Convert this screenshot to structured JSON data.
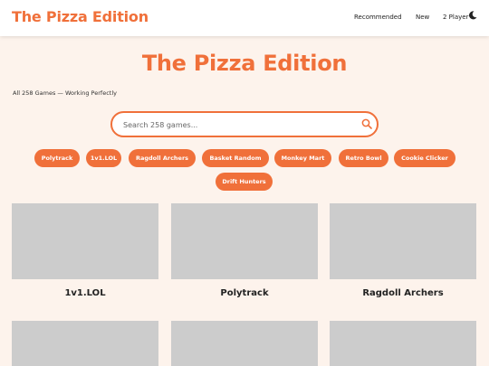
{
  "header": {
    "brand": "The Pizza Edition",
    "nav": [
      "Recommended",
      "New",
      "2 Player"
    ],
    "theme_icon": "moon-icon"
  },
  "hero": {
    "title": "The Pizza Edition",
    "subtitle": "All 258 Games — Working Perfectly"
  },
  "search": {
    "placeholder": "Search 258 games...",
    "value": "",
    "icon": "search-icon"
  },
  "chips": [
    "Polytrack",
    "1v1.LOL",
    "Ragdoll Archers",
    "Basket Random",
    "Monkey Mart",
    "Retro Bowl",
    "Cookie Clicker",
    "Drift Hunters"
  ],
  "games": [
    {
      "title": "1v1.LOL"
    },
    {
      "title": "Polytrack"
    },
    {
      "title": "Ragdoll Archers"
    }
  ],
  "colors": {
    "accent": "#f0703a",
    "background": "#fdf3ec",
    "thumb": "#cccccc"
  }
}
